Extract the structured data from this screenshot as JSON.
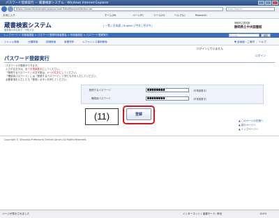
{
  "browser": {
    "title": "パスワード登録実行 － 蔵書検索システム - Windows Internet Explorer",
    "address": "https://www.lib.example.jp/opac/user/NewPasswordAction.do",
    "live_search": "Live Search",
    "command_items": [
      "お気に入り",
      "ホーム(M)",
      "ページ(P)",
      "ツール(O)",
      "ヘルプ(L)",
      "Research"
    ]
  },
  "site": {
    "logo": "蔵書検索システム",
    "logo_sub": "図書館の本を探す・予約する",
    "top_links": "| 一覧 | 日本語 | English | 中文 | 한국어 |",
    "library_name_small": "静岡県立図書館",
    "library_name": "静岡県立中央図書館"
  },
  "breadcrumb": "トップページ > 利用者認証 > パスワード登録利用者照会 > 利用者認証 > パスワード登録実行",
  "search": {
    "placeholder": "Google",
    "button": "検索"
  },
  "menu": [
    "ジャンル検索",
    "分類検索",
    "詳細検索",
    "新着資料",
    "レファレンス事例検索"
  ],
  "menu_right": "▼ 全画面・ご案内 ・ ヘルプ",
  "login": {
    "status": "ログインしていません",
    "link": "ログイン"
  },
  "page": {
    "title": "パスワード登録実行",
    "desc": [
      "パスワードの登録ができます。",
      "入力する文字は、全て半角英数字にしてください。",
      "「登録するパスワード」の文字数は、4～20文字にしてください。",
      "「確認用パスワード」には「登録するパスワード」と同じものを入力してください。",
      "必要事項を入力したら「登録」ボタンを押してください。"
    ],
    "desc_red_1": "半角英数字",
    "desc_red_2": "4～20文字"
  },
  "form": {
    "new_password_label": "登録するパスワード",
    "new_password_value": "●●●●●●●●",
    "confirm_password_label": "確認用パスワード",
    "confirm_password_value": "●●●●●●●●",
    "hint": "（半角英数字）"
  },
  "step_label": "(11)",
  "register_button": "登録",
  "side_links": [
    "▲ このページの先頭へ",
    "▲ 前のページへ",
    "▲ トップページへ"
  ],
  "copyright": "Copyright © Shizuoka Prefectural Central Library All Rights Reserved.",
  "status": {
    "left": "ページが表示されました",
    "zone": "インターネット | 保護モード: 有効",
    "zoom": "100%"
  },
  "colors": {
    "accent": "#3a6cc0",
    "highlight": "#e0141c"
  }
}
